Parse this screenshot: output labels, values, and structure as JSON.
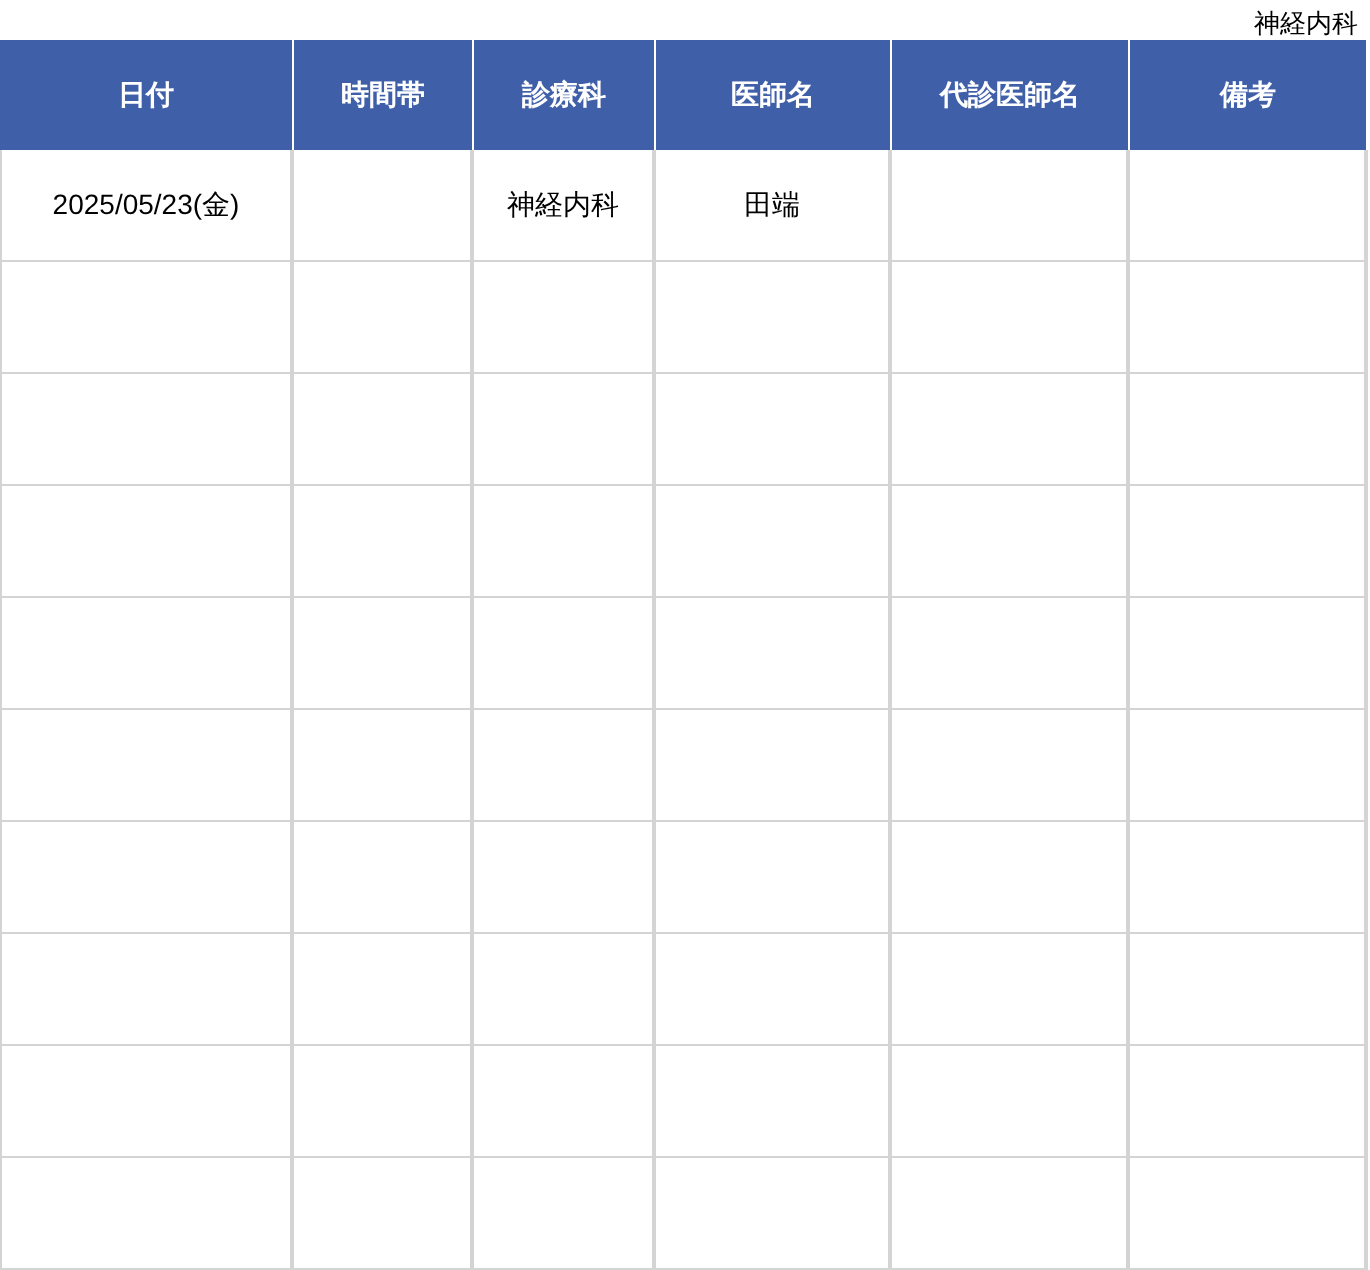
{
  "department_label": "神経内科",
  "table": {
    "columns": [
      "日付",
      "時間帯",
      "診療科",
      "医師名",
      "代診医師名",
      "備考"
    ],
    "rows": [
      {
        "cells": [
          "2025/05/23(金)",
          null,
          "神経内科",
          "田端",
          null,
          null
        ]
      }
    ]
  }
}
